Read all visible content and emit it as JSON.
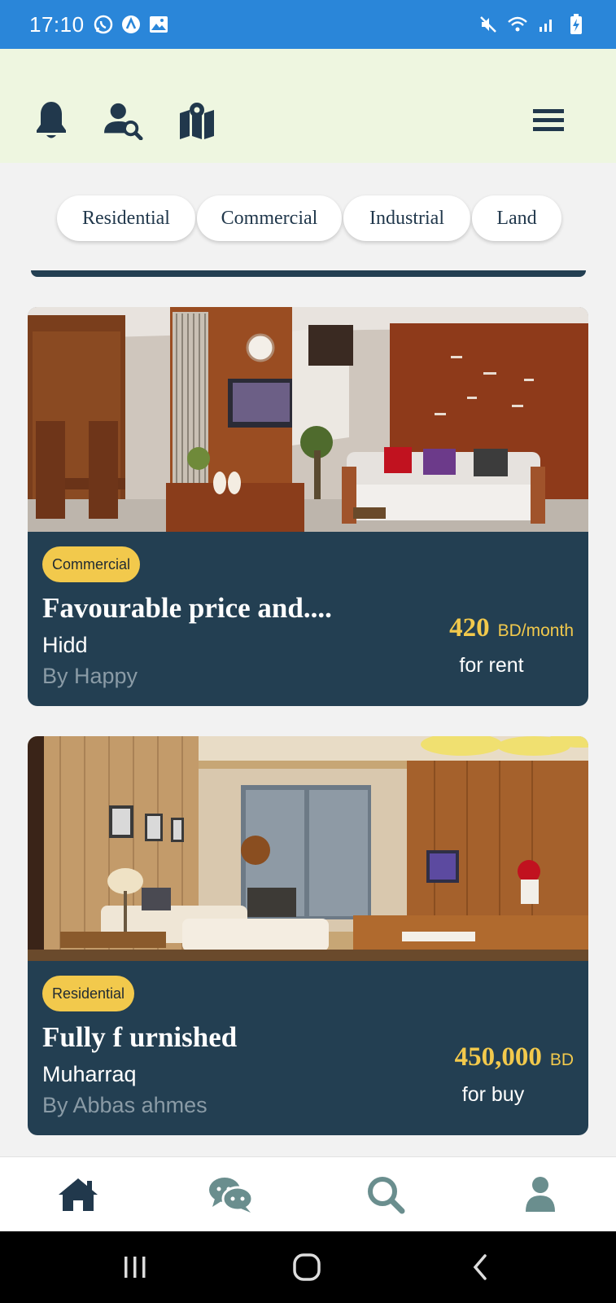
{
  "status_bar": {
    "time": "17:10",
    "left_icons": [
      "whatsapp-icon",
      "app-a-icon",
      "gallery-icon"
    ],
    "right_icons": [
      "mute-icon",
      "wifi-icon",
      "signal-icon",
      "battery-charging-icon"
    ]
  },
  "header": {
    "left_icons": [
      "bell-icon",
      "user-search-icon",
      "map-icon"
    ],
    "right_icon": "menu-icon"
  },
  "categories": [
    "Residential",
    "Commercial",
    "Industrial",
    "Land"
  ],
  "listings": [
    {
      "category": "Commercial",
      "title": "Favourable price and....",
      "location": "Hidd",
      "owner": "By Happy",
      "price": "420",
      "price_unit": "BD/month",
      "deal_type": "for rent"
    },
    {
      "category": "Residential",
      "title": "Fully f urnished",
      "location": "Muharraq",
      "owner": "By Abbas ahmes",
      "price": "450,000",
      "price_unit": "BD",
      "deal_type": "for buy"
    }
  ],
  "bottom_nav": [
    "home-icon",
    "chat-icon",
    "search-icon",
    "profile-icon"
  ],
  "system_nav": [
    "recents-icon",
    "home-circle-icon",
    "back-icon"
  ],
  "colors": {
    "status_bar": "#2a86d9",
    "header_bg": "#eef6e0",
    "card_bg": "#233f52",
    "accent_yellow": "#f2c94c",
    "icon_dark": "#21384c",
    "icon_muted": "#6a8e8e"
  }
}
